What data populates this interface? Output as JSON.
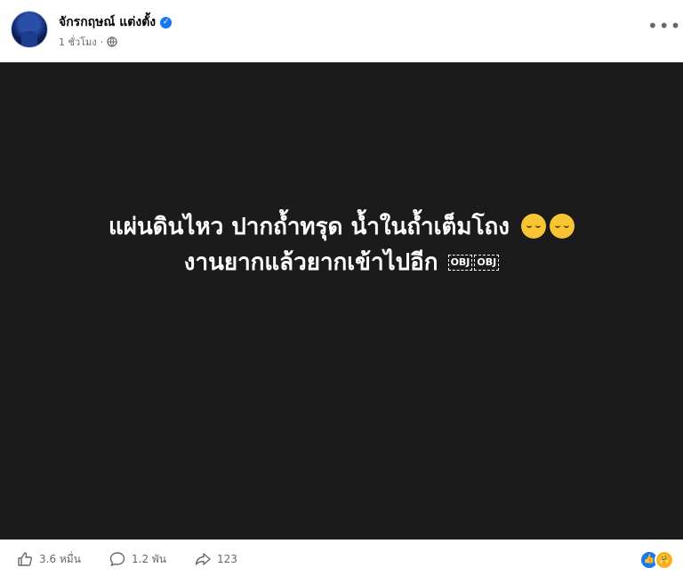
{
  "post": {
    "author": "จักรกฤษณ์ แต่งตั้ง",
    "time": "1 ชั่วโมง",
    "separator": "·",
    "verified": true,
    "privacy_icon": "globe-icon",
    "more_label": "•••"
  },
  "image_text": {
    "line1": "แผ่นดินไหว ปากถ้ำทรุด น้ำในถ้ำเต็มโถง",
    "line2": "งานยากแล้วยากเข้าไปอีก",
    "emoji1": "pensive-face-emoji",
    "obj_labels": [
      "OBJ",
      "OBJ"
    ]
  },
  "stats": {
    "likes": "3.6 หมื่น",
    "comments": "1.2 พัน",
    "shares": "123",
    "reaction_icons": [
      "like-icon",
      "care-icon"
    ]
  },
  "colors": {
    "image_bg": "#1b1b1b",
    "accent": "#1877f2",
    "muted_text": "#65676b"
  }
}
